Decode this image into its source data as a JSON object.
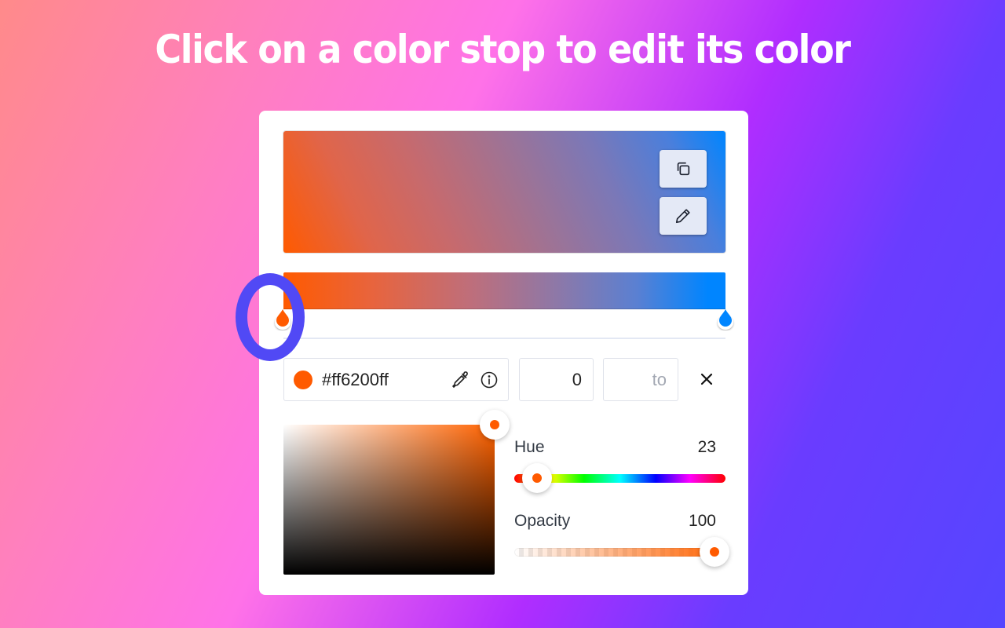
{
  "headline": "Click on a color stop to edit its color",
  "editor": {
    "preview": {
      "copy_button": {
        "icon": "copy-icon"
      },
      "edit_button": {
        "icon": "pencil-icon"
      }
    },
    "gradient_stops": [
      {
        "name": "stop-left",
        "color": "#ff6200",
        "position": 0,
        "selected": true
      },
      {
        "name": "stop-right",
        "color": "#0085ff",
        "position": 100,
        "selected": false
      }
    ],
    "selected_stop": {
      "hex": "#ff6200ff",
      "swatch_color": "#ff5a00",
      "eyedropper_icon": "eyedropper-icon",
      "info_icon": "info-icon",
      "position": "0",
      "to_placeholder": "to",
      "remove_icon": "close-icon"
    },
    "picker": {
      "hue_label": "Hue",
      "hue_value": "23",
      "hue_fraction": 0.064,
      "opacity_label": "Opacity",
      "opacity_value": "100",
      "opacity_fraction": 1.0,
      "saturation": 1.0,
      "brightness": 1.0
    }
  },
  "colors": {
    "highlight_ring": "#5149f5",
    "accent": "#ff5a00"
  }
}
